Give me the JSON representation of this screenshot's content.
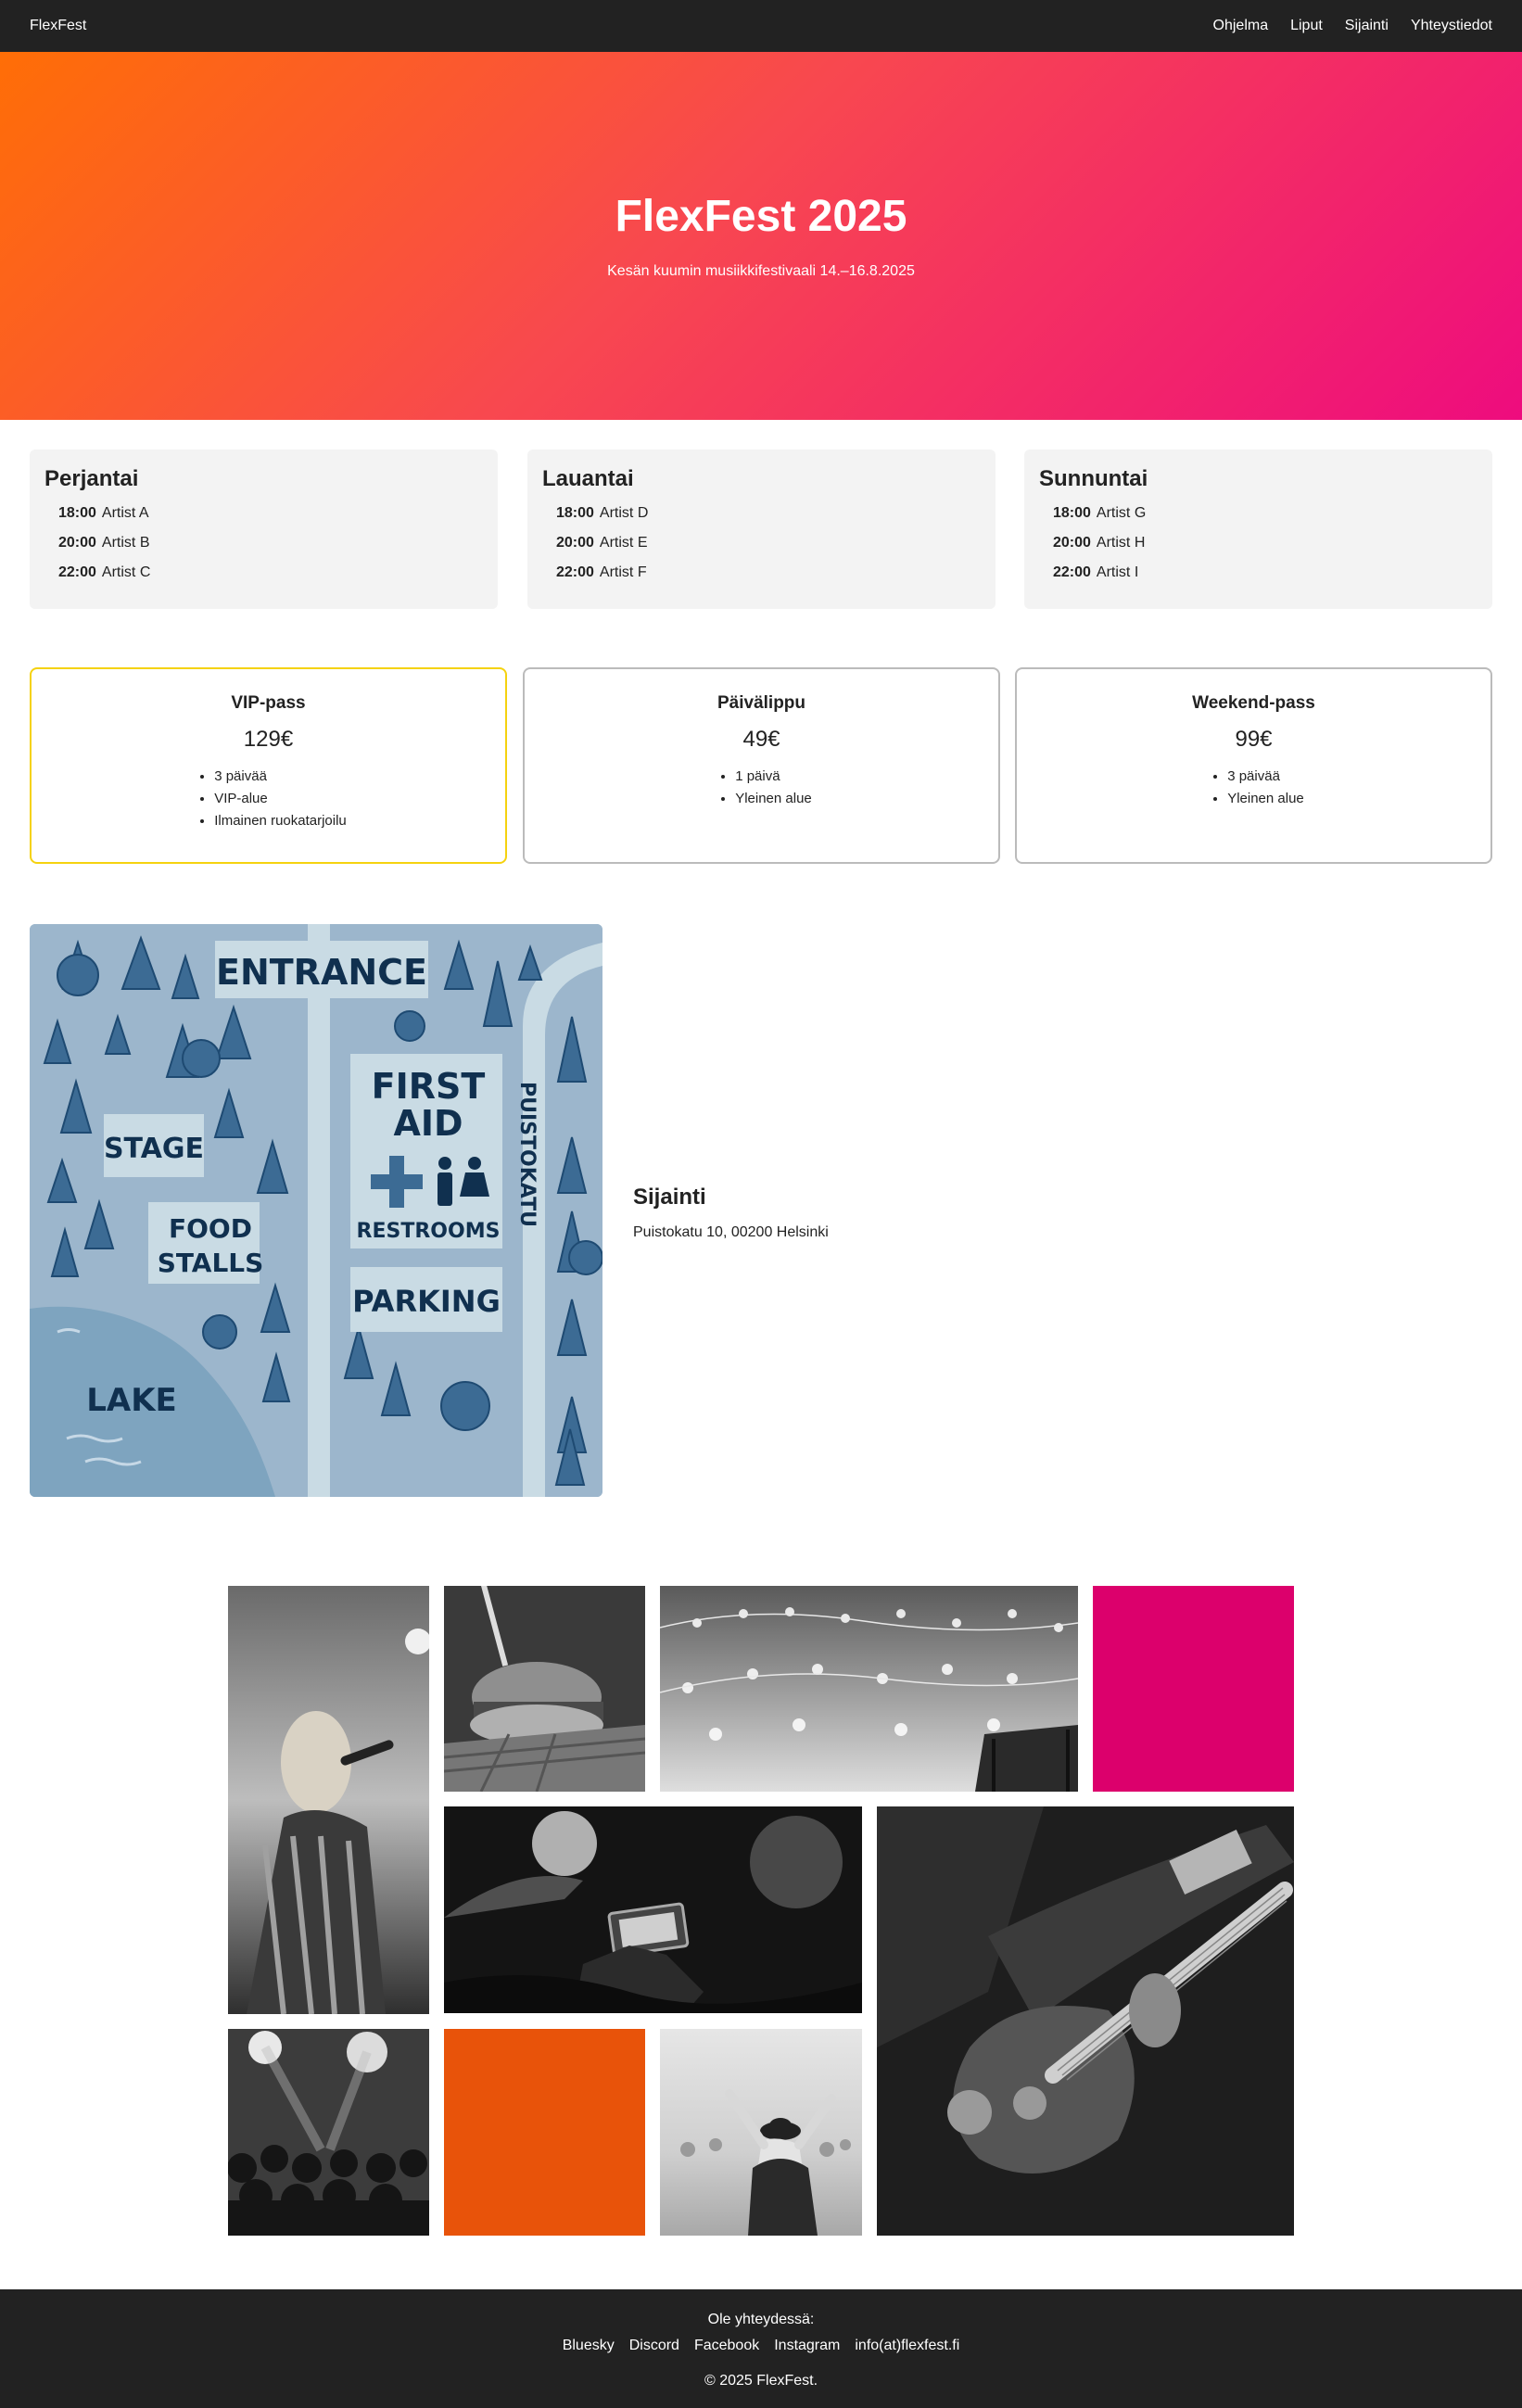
{
  "nav": {
    "brand": "FlexFest",
    "links": [
      "Ohjelma",
      "Liput",
      "Sijainti",
      "Yhteystiedot"
    ]
  },
  "hero": {
    "title": "FlexFest 2025",
    "subtitle": "Kesän kuumin musiikkifestivaali 14.–16.8.2025"
  },
  "program": [
    {
      "day": "Perjantai",
      "slots": [
        {
          "time": "18:00",
          "artist": "Artist A"
        },
        {
          "time": "20:00",
          "artist": "Artist B"
        },
        {
          "time": "22:00",
          "artist": "Artist C"
        }
      ]
    },
    {
      "day": "Lauantai",
      "slots": [
        {
          "time": "18:00",
          "artist": "Artist D"
        },
        {
          "time": "20:00",
          "artist": "Artist E"
        },
        {
          "time": "22:00",
          "artist": "Artist F"
        }
      ]
    },
    {
      "day": "Sunnuntai",
      "slots": [
        {
          "time": "18:00",
          "artist": "Artist G"
        },
        {
          "time": "20:00",
          "artist": "Artist H"
        },
        {
          "time": "22:00",
          "artist": "Artist I"
        }
      ]
    }
  ],
  "tickets": [
    {
      "name": "VIP-pass",
      "price": "129€",
      "features": [
        "3 päivää",
        "VIP-alue",
        "Ilmainen ruokatarjoilu"
      ]
    },
    {
      "name": "Päivälippu",
      "price": "49€",
      "features": [
        "1 päivä",
        "Yleinen alue"
      ]
    },
    {
      "name": "Weekend-pass",
      "price": "99€",
      "features": [
        "3 päivää",
        "Yleinen alue"
      ]
    }
  ],
  "map": {
    "labels": {
      "entrance": "ENTRANCE",
      "stage": "STAGE",
      "food_1": "FOOD",
      "food_2": "STALLS",
      "first_aid_1": "FIRST",
      "first_aid_2": "AID",
      "restrooms": "RESTROOMS",
      "parking": "PARKING",
      "lake": "LAKE",
      "street": "PUISTOKATU"
    }
  },
  "location": {
    "title": "Sijainti",
    "address": "Puistokatu 10, 00200 Helsinki"
  },
  "gallery": {
    "accent_pink": "#dc006c",
    "accent_orange": "#e8530a"
  },
  "footer": {
    "contact": "Ole yhteydessä:",
    "links": [
      "Bluesky",
      "Discord",
      "Facebook",
      "Instagram",
      "info(at)flexfest.fi"
    ],
    "copyright": "© 2025 FlexFest."
  }
}
